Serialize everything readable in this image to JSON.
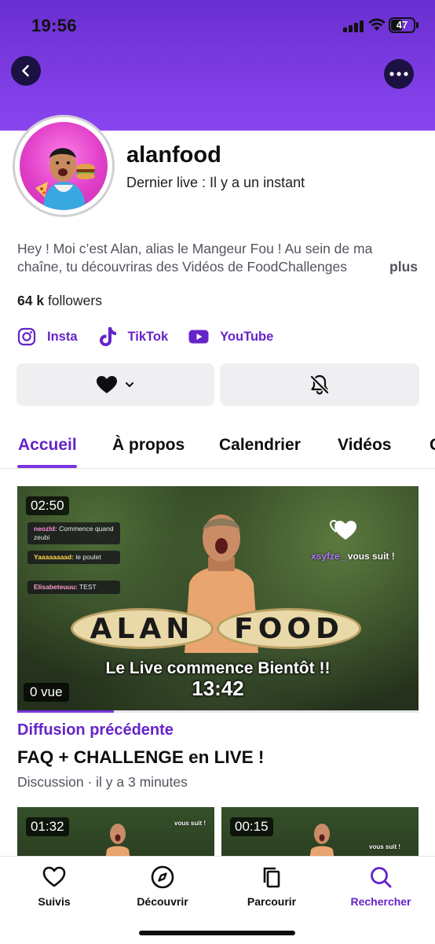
{
  "status_bar": {
    "time": "19:56",
    "battery": "47",
    "battery_level": 0.47
  },
  "header": {
    "back_icon": "chevron-left-icon",
    "more_icon": "more-horizontal-icon",
    "accent": "#7b3fe4"
  },
  "profile": {
    "name": "alanfood",
    "last_live": "Dernier live : Il y a un instant",
    "bio_line1": "Hey ! Moi c’est Alan, alias le Mangeur Fou ! Au sein de ma",
    "bio_line2": "chaîne, tu découvriras des Vidéos de FoodChallenges",
    "bio_more": "plus",
    "followers_count": "64 k",
    "followers_label": "followers"
  },
  "socials": [
    {
      "label": "Insta",
      "icon": "instagram-icon"
    },
    {
      "label": "TikTok",
      "icon": "tiktok-icon"
    },
    {
      "label": "YouTube",
      "icon": "youtube-icon"
    }
  ],
  "actions": {
    "follow_icon": "heart-icon",
    "notify_icon": "bell-off-icon"
  },
  "tabs": [
    "Accueil",
    "À propos",
    "Calendrier",
    "Vidéos",
    "C"
  ],
  "active_tab": "Accueil",
  "featured": {
    "duration": "02:50",
    "views": "0 vue",
    "watch_progress": 0.24,
    "chat": [
      {
        "user": "neozld:",
        "text": "Commence quand zeubi"
      },
      {
        "user": "Yaaaaaaaad:",
        "text": "le poulet"
      },
      {
        "user": "Elisabeteuuu:",
        "text": "TEST"
      }
    ],
    "sign_left": "ALAN",
    "sign_right": "FOOD",
    "follow_alert_user": "xsyfze_",
    "follow_alert_text": "vous suit !",
    "overlay_line1": "Le Live commence Bientôt !!",
    "overlay_line2": "13:42",
    "section": "Diffusion précédente",
    "title": "FAQ + CHALLENGE en LIVE !",
    "meta": "Discussion · il y a 3 minutes"
  },
  "more_videos": [
    {
      "duration": "01:32",
      "alert": "vous suit !"
    },
    {
      "duration": "00:15",
      "alert": "vous suit !"
    }
  ],
  "bottom_nav": [
    {
      "label": "Suivis",
      "icon": "heart-outline-icon"
    },
    {
      "label": "Découvrir",
      "icon": "compass-icon"
    },
    {
      "label": "Parcourir",
      "icon": "copy-icon"
    },
    {
      "label": "Rechercher",
      "icon": "search-icon"
    }
  ],
  "colors": {
    "brand": "#6524c9",
    "header_top": "#6a2fd0",
    "header_bottom": "#8a45f0"
  }
}
